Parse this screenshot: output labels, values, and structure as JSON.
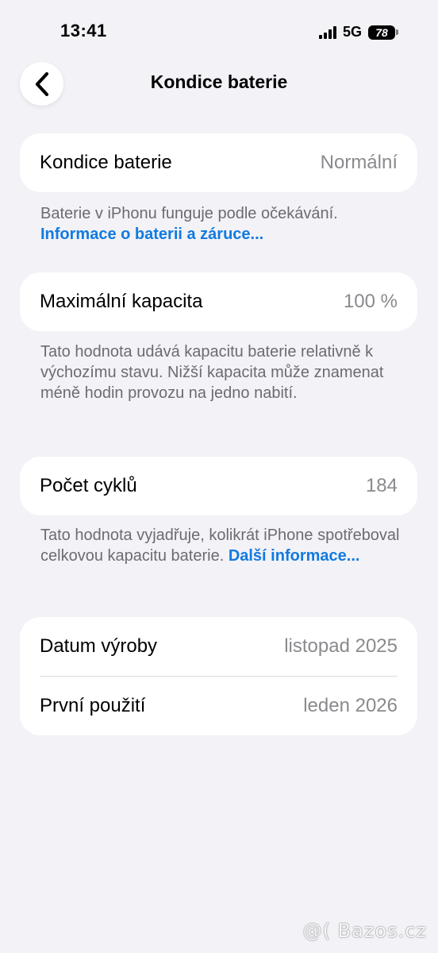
{
  "status_bar": {
    "time": "13:41",
    "network": "5G",
    "battery_level": "78"
  },
  "nav": {
    "title": "Kondice baterie",
    "back_icon": "chevron-left-icon"
  },
  "battery_health": {
    "label": "Kondice baterie",
    "value": "Normální",
    "footnote_text": "Baterie v iPhonu funguje podle očekávání. ",
    "footnote_link": "Informace o baterii a záruce..."
  },
  "max_capacity": {
    "label": "Maximální kapacita",
    "value": "100 %",
    "footnote_text": "Tato hodnota udává kapacitu baterie relativně k výchozímu stavu. Nižší kapacita může znamenat méně hodin provozu na jedno nabití."
  },
  "cycle_count": {
    "label": "Počet cyklů",
    "value": "184",
    "footnote_text": "Tato hodnota vyjadřuje, kolikrát iPhone spotřeboval celkovou kapacitu baterie. ",
    "footnote_link": "Další informace..."
  },
  "dates": {
    "manufacture_label": "Datum výroby",
    "manufacture_value": "listopad 2025",
    "first_use_label": "První použití",
    "first_use_value": "leden 2026"
  },
  "watermark": "@( Bazos.cz",
  "colors": {
    "background": "#f2f2f7",
    "card": "#ffffff",
    "link": "#127ae0",
    "secondary_text": "#8a8a8e"
  }
}
